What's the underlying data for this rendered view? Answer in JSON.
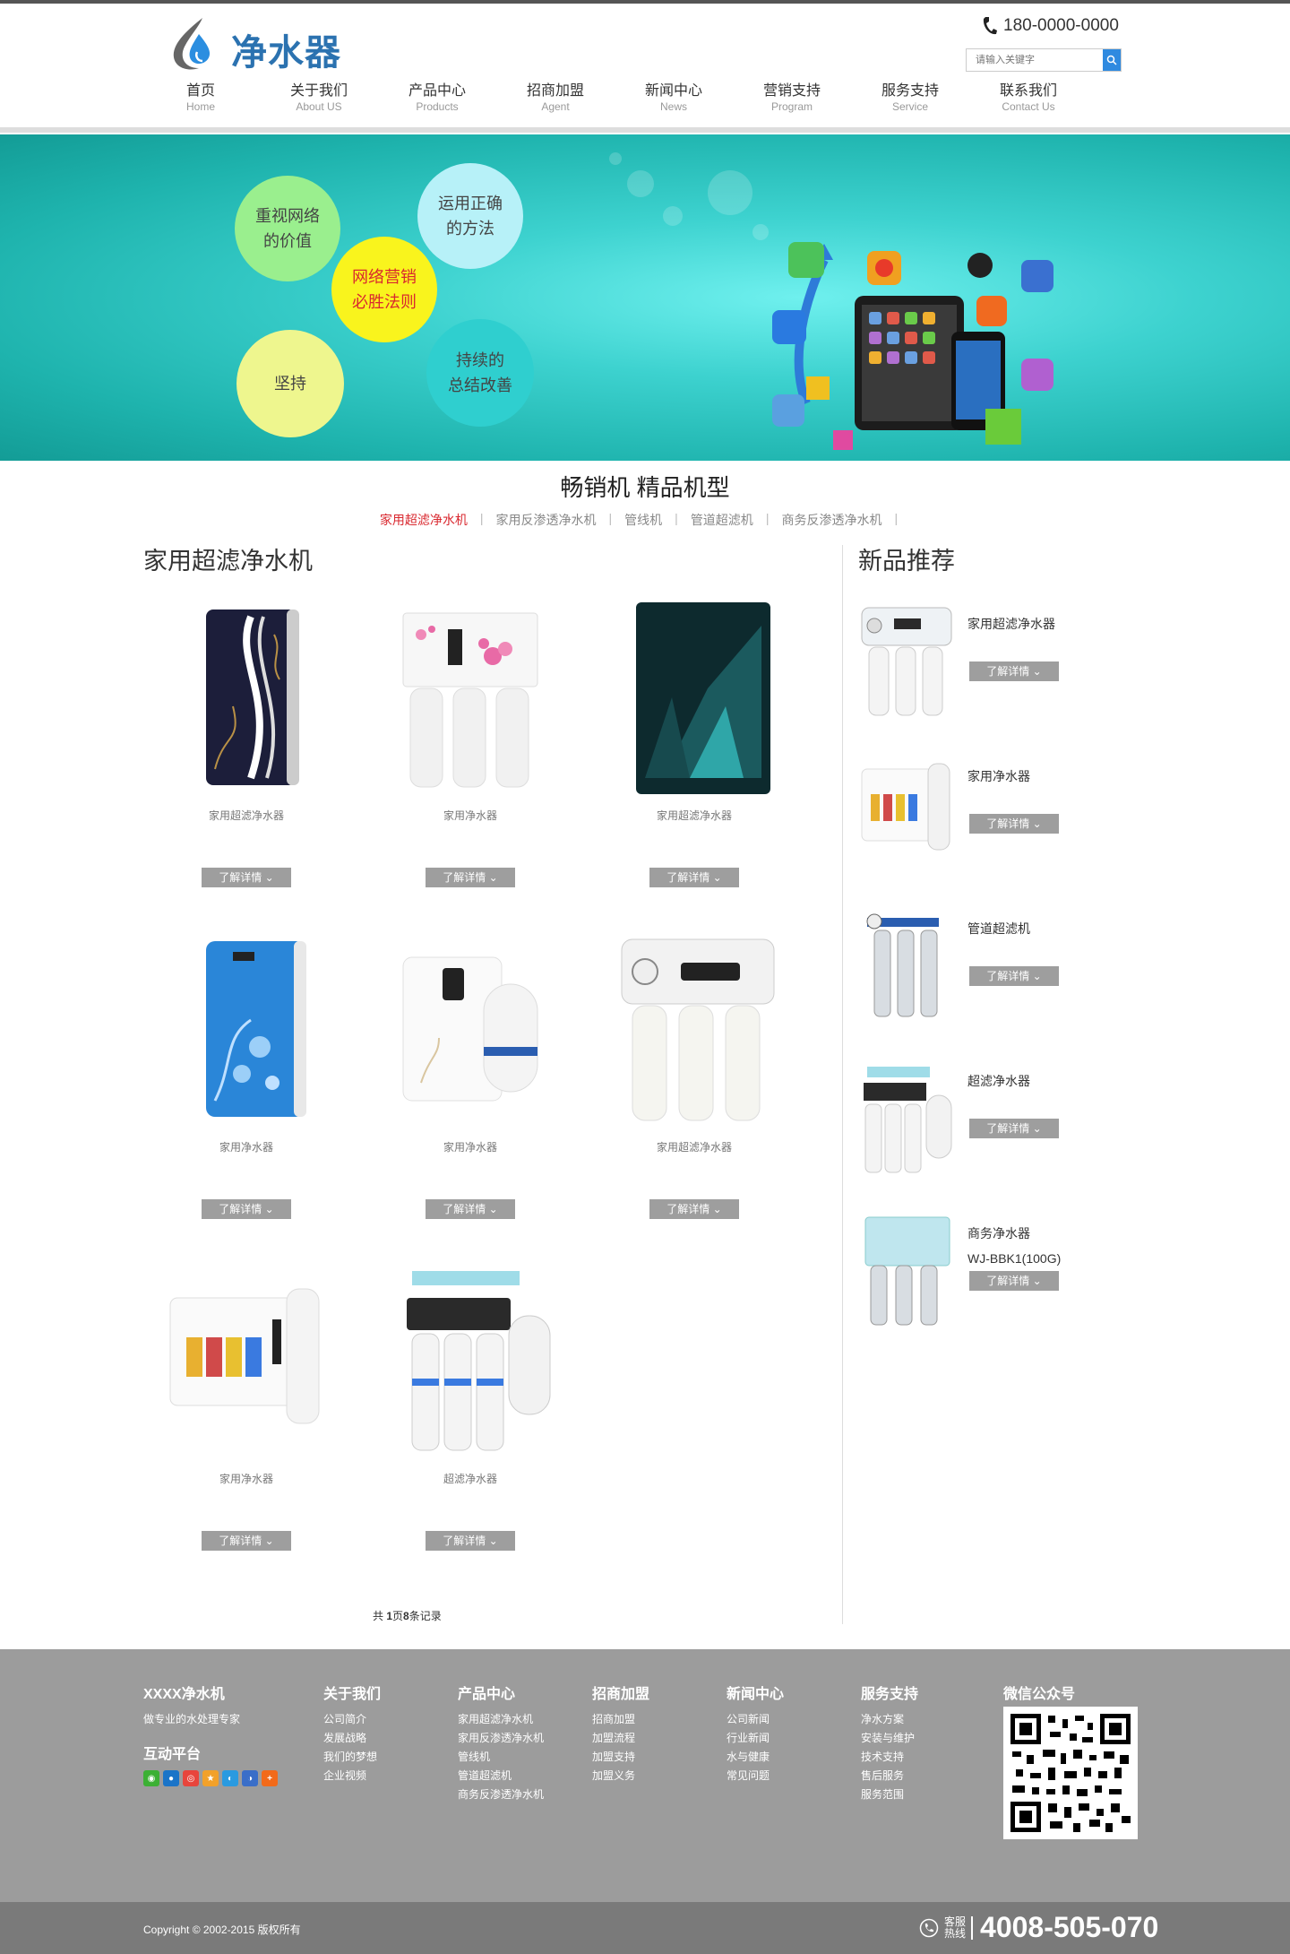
{
  "header": {
    "logo_text": "净水器",
    "phone": "180-0000-0000",
    "search_placeholder": "请输入关键字",
    "nav": [
      {
        "zh": "首页",
        "en": "Home"
      },
      {
        "zh": "关于我们",
        "en": "About US"
      },
      {
        "zh": "产品中心",
        "en": "Products"
      },
      {
        "zh": "招商加盟",
        "en": "Agent"
      },
      {
        "zh": "新闻中心",
        "en": "News"
      },
      {
        "zh": "营销支持",
        "en": "Program"
      },
      {
        "zh": "服务支持",
        "en": "Service"
      },
      {
        "zh": "联系我们",
        "en": "Contact Us"
      }
    ]
  },
  "banner": {
    "bubbles": [
      "重视网络的价值",
      "运用正确的方法",
      "网络营销必胜法则",
      "坚持",
      "持续的总结改善"
    ],
    "bubble_lines": [
      [
        "重视网络",
        "的价值"
      ],
      [
        "运用正确",
        "的方法"
      ],
      [
        "网络营销",
        "必胜法则"
      ],
      [
        "坚持"
      ],
      [
        "持续的",
        "总结改善"
      ]
    ]
  },
  "section": {
    "title": "畅销机 精品机型",
    "tabs": [
      "家用超滤净水机",
      "家用反渗透净水机",
      "管线机",
      "管道超滤机",
      "商务反渗透净水机"
    ],
    "active_tab": 0
  },
  "main": {
    "title": "家用超滤净水机",
    "detail_label": "了解详情",
    "products": [
      {
        "name": "家用超滤净水器",
        "img": "navy-panel"
      },
      {
        "name": "家用净水器",
        "img": "floral-3filter"
      },
      {
        "name": "家用超滤净水器",
        "img": "dark-teal"
      },
      {
        "name": "家用净水器",
        "img": "blue-floral"
      },
      {
        "name": "家用净水器",
        "img": "white-tank"
      },
      {
        "name": "家用超滤净水器",
        "img": "gauge-3filter"
      },
      {
        "name": "家用净水器",
        "img": "white-box"
      },
      {
        "name": "超滤净水器",
        "img": "ro-system"
      }
    ],
    "pagination": {
      "prefix": "共 ",
      "pages": "1",
      "mid": "页",
      "records": "8",
      "suffix": "条记录"
    }
  },
  "sidebar": {
    "title": "新品推荐",
    "items": [
      {
        "name": "家用超滤净水器",
        "sub": ""
      },
      {
        "name": "家用净水器",
        "sub": ""
      },
      {
        "name": "管道超滤机",
        "sub": ""
      },
      {
        "name": "超滤净水器",
        "sub": ""
      },
      {
        "name": "商务净水器",
        "sub": "WJ-BBK1(100G)"
      }
    ]
  },
  "footer": {
    "brand": "XXXX净水机",
    "slogan": "做专业的水处理专家",
    "interact_title": "互动平台",
    "columns": [
      {
        "title": "关于我们",
        "links": [
          "公司简介",
          "发展战略",
          "我们的梦想",
          "企业视频"
        ]
      },
      {
        "title": "产品中心",
        "links": [
          "家用超滤净水机",
          "家用反渗透净水机",
          "管线机",
          "管道超滤机",
          "商务反渗透净水机"
        ]
      },
      {
        "title": "招商加盟",
        "links": [
          "招商加盟",
          "加盟流程",
          "加盟支持",
          "加盟义务"
        ]
      },
      {
        "title": "新闻中心",
        "links": [
          "公司新闻",
          "行业新闻",
          "水与健康",
          "常见问题"
        ]
      },
      {
        "title": "服务支持",
        "links": [
          "净水方案",
          "安装与维护",
          "技术支持",
          "售后服务",
          "服务范围"
        ]
      }
    ],
    "wechat_title": "微信公众号",
    "copyright": "Copyright © 2002-2015 版权所有",
    "hotline_label_1": "客服",
    "hotline_label_2": "热线",
    "hotline": "4008-505-070"
  },
  "colors": {
    "accent_blue": "#2f8ae0",
    "active_red": "#d9282f",
    "button_gray": "#9e9e9e",
    "footer_gray": "#9c9c9c",
    "banner_teal": "#2ec6c1"
  }
}
